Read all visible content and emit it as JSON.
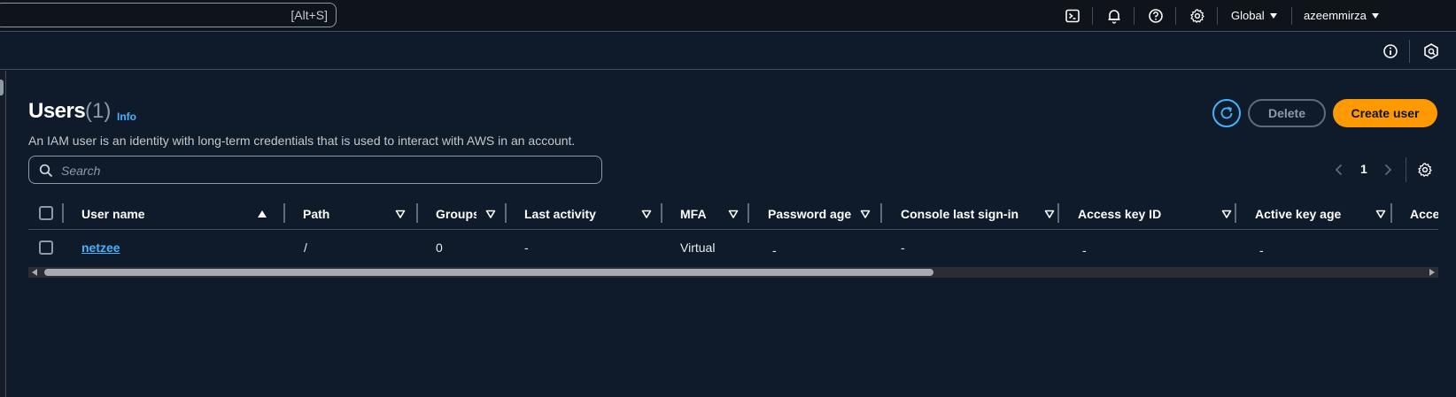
{
  "topnav": {
    "search_shortcut": "[Alt+S]",
    "icons": [
      "cloudshell-icon",
      "bell-icon",
      "help-icon",
      "gear-icon"
    ],
    "region_label": "Global",
    "account_label": "azeemmirza"
  },
  "subnav": {
    "icons": [
      "info-icon",
      "cloud-notes-icon"
    ]
  },
  "page": {
    "title": "Users",
    "count": "(1)",
    "info_link": "Info",
    "description": "An IAM user is an identity with long-term credentials that is used to interact with AWS in an account."
  },
  "actions": {
    "delete_label": "Delete",
    "create_label": "Create user"
  },
  "search": {
    "placeholder": "Search",
    "value": ""
  },
  "pagination": {
    "current_page": "1"
  },
  "table": {
    "columns": [
      "User name",
      "Path",
      "Groups",
      "Last activity",
      "MFA",
      "Password age",
      "Console last sign-in",
      "Access key ID",
      "Active key age",
      "Access"
    ],
    "rows": [
      {
        "user_name": "netzee",
        "path": "/",
        "groups": "0",
        "last_activity": "-",
        "mfa": "Virtual",
        "password_age": "-",
        "console_last_sign_in": "-",
        "access_key_id": "-",
        "active_key_age": "-"
      }
    ]
  },
  "colors": {
    "background": "#0f1b2a",
    "topbar": "#0f141a",
    "primary_button": "#ff9900",
    "link": "#42b4ff",
    "border": "#414d5c"
  },
  "scrollbar": {
    "horizontal_visible_fraction": 0.63
  }
}
